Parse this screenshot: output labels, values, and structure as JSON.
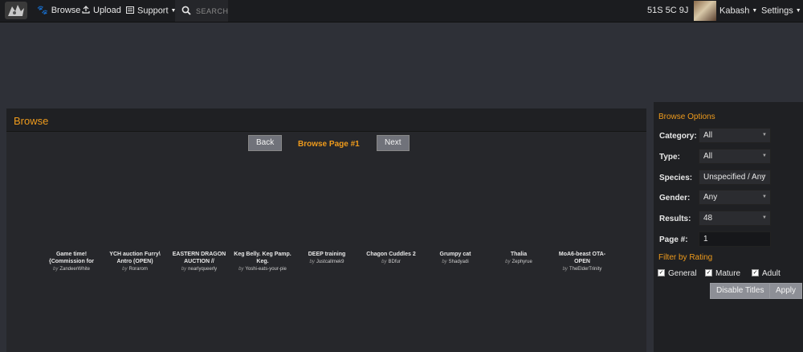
{
  "nav": {
    "browse": "Browse",
    "upload": "Upload",
    "support": "Support",
    "search_placeholder": "SEARCH",
    "notifications": "51S 5C 9J",
    "username": "Kabash",
    "settings": "Settings"
  },
  "main": {
    "title": "Browse",
    "back": "Back",
    "page_label": "Browse Page #1",
    "next": "Next"
  },
  "gallery": [
    {
      "title": "Game time! {Commission for",
      "by": "by",
      "author": "ZandeerWhite"
    },
    {
      "title": "YCH auction Furry\\ Antro (OPEN)",
      "by": "by",
      "author": "Rorarom"
    },
    {
      "title": "EASTERN DRAGON AUCTION //",
      "by": "by",
      "author": "nearlyqueerly"
    },
    {
      "title": "Keg Belly. Keg Pamp. Keg.",
      "by": "by",
      "author": "Yoshi-eats-your-pie"
    },
    {
      "title": "DEEP training",
      "by": "by",
      "author": "Justcallmek9"
    },
    {
      "title": "Chagon Cuddles 2",
      "by": "by",
      "author": "BDfur"
    },
    {
      "title": "Grumpy cat",
      "by": "by",
      "author": "Shadyadi"
    },
    {
      "title": "Thalia",
      "by": "by",
      "author": "Zephyrue"
    },
    {
      "title": "MoA6-beast OTA-OPEN",
      "by": "by",
      "author": "TheElderTrinity"
    }
  ],
  "sidebar": {
    "heading": "Browse Options",
    "category_label": "Category:",
    "category_value": "All",
    "type_label": "Type:",
    "type_value": "All",
    "species_label": "Species:",
    "species_value": "Unspecified / Any",
    "gender_label": "Gender:",
    "gender_value": "Any",
    "results_label": "Results:",
    "results_value": "48",
    "page_label": "Page #:",
    "page_value": "1",
    "rating_heading": "Filter by Rating",
    "general": "General",
    "mature": "Mature",
    "adult": "Adult",
    "disable_titles": "Disable Titles",
    "apply": "Apply"
  },
  "colors": {
    "accent": "#ef9b1c",
    "topbar": "#1b1c1f",
    "page_bg": "#2e3037",
    "panel_bg": "#26272b"
  }
}
